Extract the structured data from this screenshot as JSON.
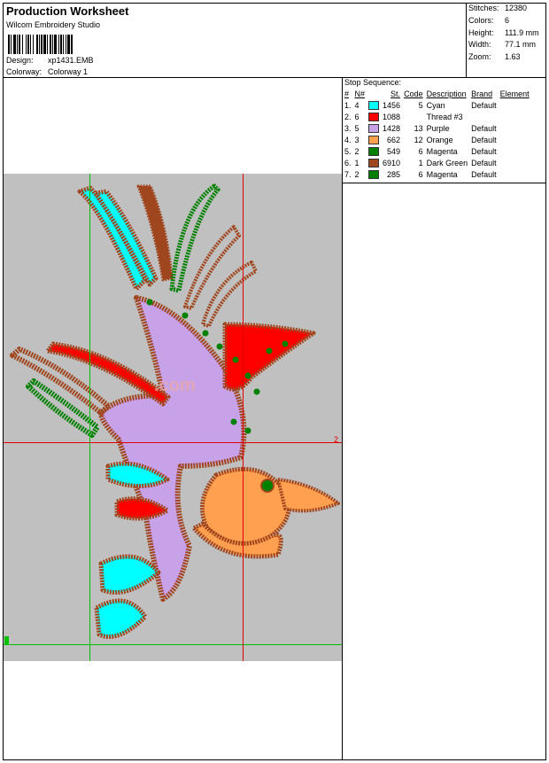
{
  "header": {
    "title": "Production Worksheet",
    "software": "Wilcom Embroidery Studio",
    "design_label": "Design:",
    "design_value": "xp1431.EMB",
    "colorway_label": "Colorway:",
    "colorway_value": "Colorway 1"
  },
  "stats": [
    {
      "label": "Stitches:",
      "value": "12380"
    },
    {
      "label": "Colors:",
      "value": "6"
    },
    {
      "label": "Height:",
      "value": "111.9 mm"
    },
    {
      "label": "Width:",
      "value": "77.1 mm"
    },
    {
      "label": "Zoom:",
      "value": "1.63"
    }
  ],
  "sequence": {
    "title": "Stop Sequence:",
    "columns": [
      "#",
      "N#",
      "St.",
      "Code",
      "Description",
      "Brand",
      "Element"
    ],
    "rows": [
      {
        "idx": "1.",
        "n": "4",
        "color": "#00ffff",
        "st": "1456",
        "code": "5",
        "desc": "Cyan",
        "brand": "Default"
      },
      {
        "idx": "2.",
        "n": "6",
        "color": "#ff0000",
        "st": "1088",
        "code": "",
        "desc": "Thread #3",
        "brand": ""
      },
      {
        "idx": "3.",
        "n": "5",
        "color": "#c8a2e8",
        "st": "1428",
        "code": "13",
        "desc": "Purple",
        "brand": "Default"
      },
      {
        "idx": "4.",
        "n": "3",
        "color": "#ffa050",
        "st": "662",
        "code": "12",
        "desc": "Orange",
        "brand": "Default"
      },
      {
        "idx": "5.",
        "n": "2",
        "color": "#008000",
        "st": "549",
        "code": "6",
        "desc": "Magenta",
        "brand": "Default"
      },
      {
        "idx": "6.",
        "n": "1",
        "color": "#a0461e",
        "st": "6910",
        "code": "1",
        "desc": "Dark Green",
        "brand": "Default"
      },
      {
        "idx": "7.",
        "n": "2",
        "color": "#008000",
        "st": "285",
        "code": "6",
        "desc": "Magenta",
        "brand": "Default"
      }
    ]
  },
  "canvas": {
    "background": "#c0c0c0",
    "guide_colors": {
      "green": "#00c000",
      "red": "#e00000"
    },
    "guide_labels": {
      "red": "2",
      "green": "1"
    },
    "watermark": ".com"
  }
}
